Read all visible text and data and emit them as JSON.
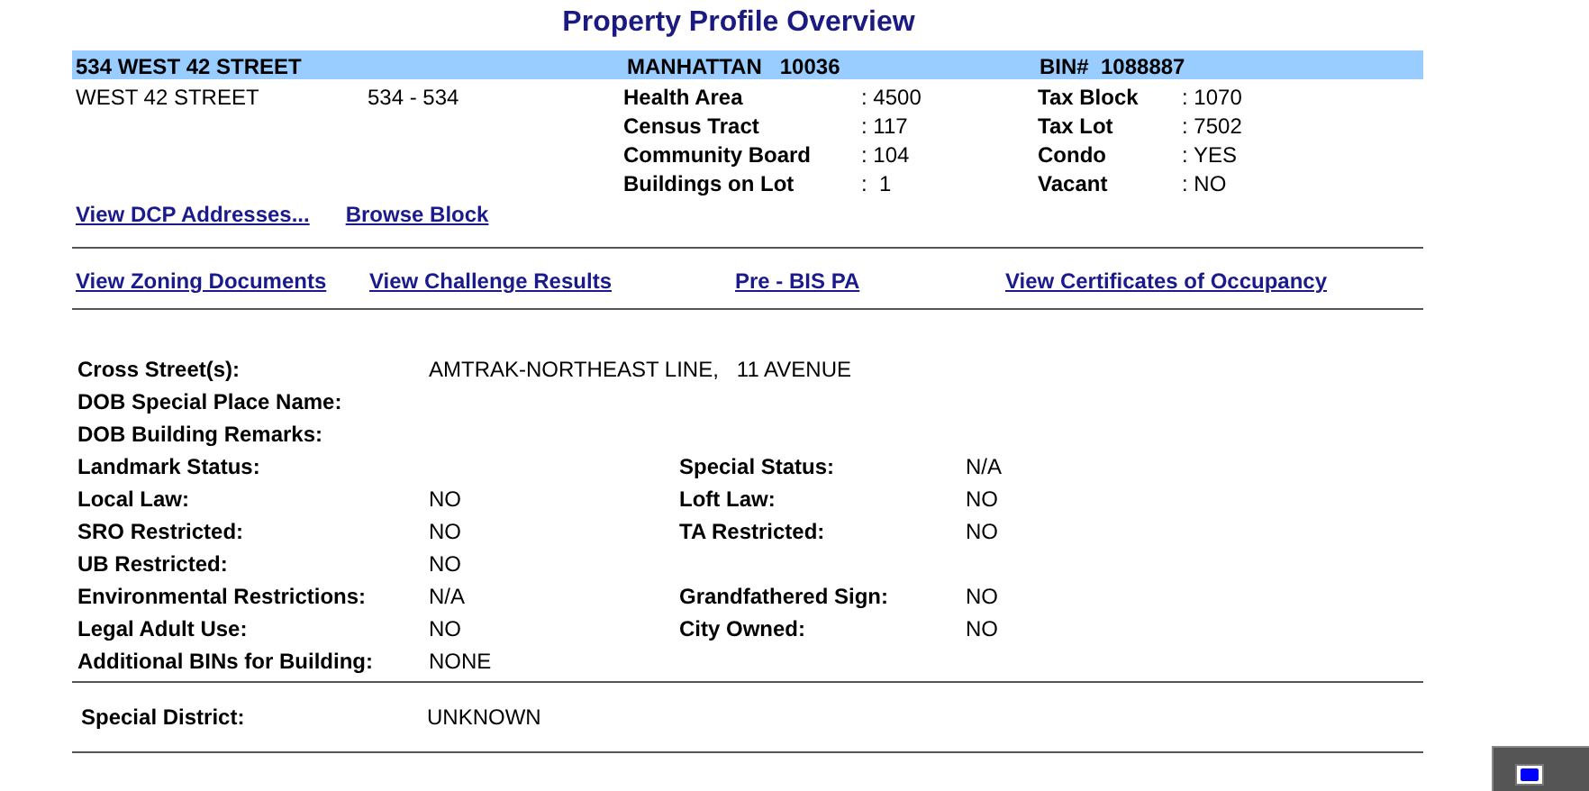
{
  "title": "Property Profile Overview",
  "header": {
    "address": "534 WEST 42 STREET",
    "borough": "MANHATTAN",
    "zip": "10036",
    "bin": "BIN#  1088887"
  },
  "street": {
    "name": "WEST 42 STREET",
    "range": "534 - 534"
  },
  "lot_info": [
    {
      "label": "Health Area",
      "value": ": 4500",
      "label_2": "Tax Block",
      "value_2": ": 1070"
    },
    {
      "label": "Census Tract",
      "value": ": 117",
      "label_2": "Tax Lot",
      "value_2": ": 7502"
    },
    {
      "label": "Community Board",
      "value": ": 104",
      "label_2": "Condo",
      "value_2": ": YES"
    },
    {
      "label": "Buildings on Lot",
      "value": ":  1",
      "label_2": "Vacant",
      "value_2": ": NO"
    }
  ],
  "links_1": [
    "View DCP Addresses...",
    "Browse Block"
  ],
  "links_2": [
    "View Zoning Documents",
    "View Challenge Results",
    "Pre - BIS PA",
    "View Certificates of Occupancy"
  ],
  "details": [
    {
      "label": "Cross Street(s):",
      "value": "AMTRAK-NORTHEAST LINE,   11 AVENUE"
    },
    {
      "label": "DOB Special Place Name:"
    },
    {
      "label": "DOB Building Remarks:"
    },
    {
      "label": "Landmark Status:",
      "label_2": "Special Status:",
      "value_2": "N/A"
    },
    {
      "label": "Local Law:",
      "value": "NO",
      "label_2": "Loft Law:",
      "value_2": "NO"
    },
    {
      "label": "SRO Restricted:",
      "value": "NO",
      "label_2": "TA Restricted:",
      "value_2": "NO"
    },
    {
      "label": "UB Restricted:",
      "value": "NO"
    },
    {
      "label": "Environmental Restrictions:",
      "value": "N/A",
      "label_2": "Grandfathered Sign:",
      "value_2": "NO"
    },
    {
      "label": "Legal Adult Use:",
      "value": "NO",
      "label_2": "City Owned:",
      "value_2": "NO"
    },
    {
      "label": "Additional BINs for Building:",
      "value": "NONE"
    }
  ],
  "special_district": {
    "label": "Special District:",
    "value": "UNKNOWN"
  }
}
